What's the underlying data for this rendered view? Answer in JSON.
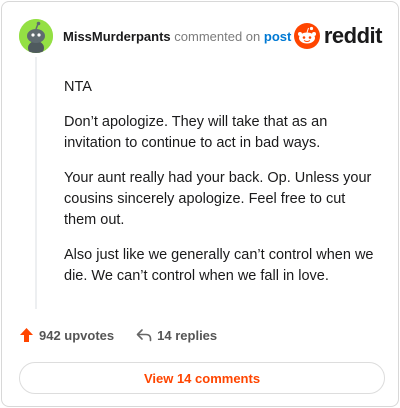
{
  "comment": {
    "username": "MissMurderpants",
    "action_text": "commented on",
    "post_link_text": "post",
    "paragraphs": [
      "NTA",
      "Don’t apologize. They will take that as an invitation to continue to act in bad ways.",
      "Your aunt really had your back. Op. Unless your cousins sincerely apologize. Feel free to cut them out.",
      "Also just like we generally can’t control when we die. We can’t control when we fall in love."
    ]
  },
  "brand": {
    "wordmark": "reddit",
    "accent_color": "#ff4500",
    "icon": "reddit-snoo-icon"
  },
  "stats": {
    "upvotes_label": "942 upvotes",
    "replies_label": "14 replies",
    "upvote_icon": "upvote-arrow-icon",
    "reply_icon": "reply-arrow-icon"
  },
  "footer": {
    "view_comments_label": "View 14 comments"
  },
  "colors": {
    "avatar_bg": "#94e044",
    "link_blue": "#0079d3",
    "muted_text": "#7c7c7c"
  }
}
